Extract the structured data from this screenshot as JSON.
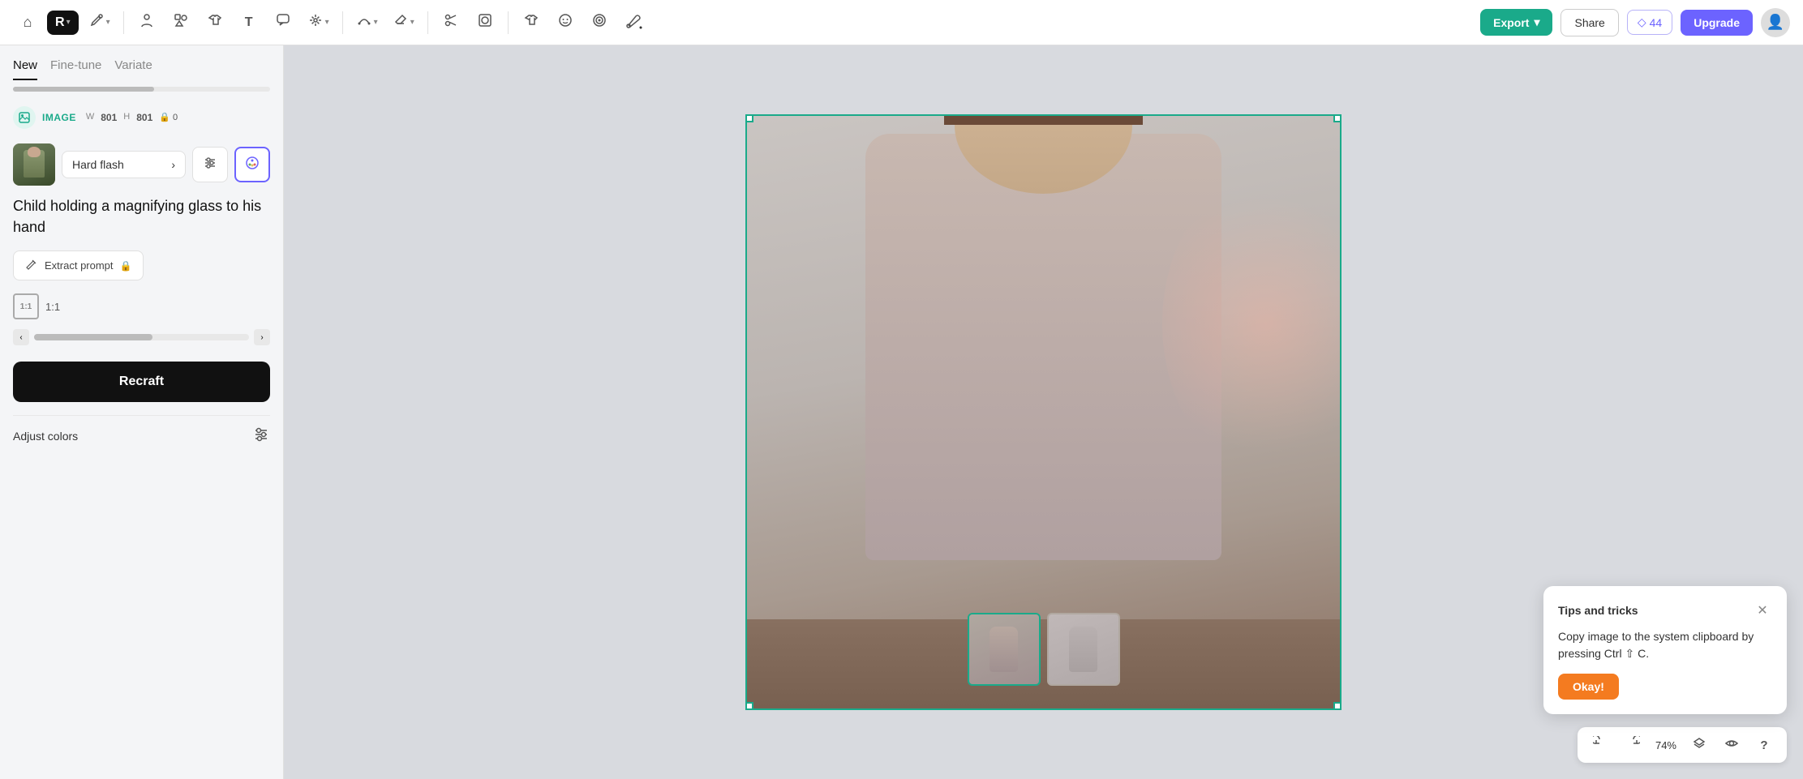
{
  "toolbar": {
    "home_icon": "⌂",
    "logo_label": "R",
    "arrow_icon": "▾",
    "pen_icon": "✒",
    "tools": [
      {
        "name": "person-icon",
        "label": "👤",
        "tooltip": "Character"
      },
      {
        "name": "shapes-icon",
        "label": "⬡",
        "tooltip": "Shapes"
      },
      {
        "name": "tshirt-icon",
        "label": "👕",
        "tooltip": "T-shirt"
      },
      {
        "name": "text-icon",
        "label": "T",
        "tooltip": "Text"
      },
      {
        "name": "bubble-icon",
        "label": "💬",
        "tooltip": "Speech bubble"
      },
      {
        "name": "magic-icon",
        "label": "✦",
        "tooltip": "Magic"
      },
      {
        "name": "curve-icon",
        "label": "⌒",
        "tooltip": "Curve"
      },
      {
        "name": "eraser-icon",
        "label": "◎",
        "tooltip": "Eraser"
      },
      {
        "name": "scissors-icon",
        "label": "✂",
        "tooltip": "Scissors"
      },
      {
        "name": "mask-icon",
        "label": "⊞",
        "tooltip": "Mask"
      },
      {
        "name": "shirt2-icon",
        "label": "👕",
        "tooltip": "Shirt 2"
      },
      {
        "name": "face-icon",
        "label": "☺",
        "tooltip": "Face"
      },
      {
        "name": "target-icon",
        "label": "◎",
        "tooltip": "Target"
      },
      {
        "name": "paint-icon",
        "label": "🖌",
        "tooltip": "Paint"
      }
    ],
    "export_label": "Export",
    "share_label": "Share",
    "credits_icon": "◇",
    "credits_count": "44",
    "upgrade_label": "Upgrade"
  },
  "left_panel": {
    "tabs": [
      {
        "label": "New",
        "active": true
      },
      {
        "label": "Fine-tune",
        "active": false
      },
      {
        "label": "Variate",
        "active": false
      }
    ],
    "image_meta": {
      "icon": "◉",
      "label": "IMAGE",
      "w_label": "W",
      "w_value": "801",
      "h_label": "H",
      "h_value": "801",
      "lock_value": "0"
    },
    "style": {
      "name": "Hard flash",
      "arrow": "›"
    },
    "prompt": {
      "text": "Child holding a magnifying glass to his hand"
    },
    "extract_prompt": {
      "label": "Extract prompt",
      "lock_icon": "🔒"
    },
    "ratio": {
      "label": "1:1"
    },
    "recraft_btn": "Recraft",
    "adjust_colors": "Adjust colors"
  },
  "canvas": {
    "zoom_level": "74%"
  },
  "tips": {
    "title": "Tips and tricks",
    "body": "Copy image to the system clipboard by pressing Ctrl ⇧ C.",
    "okay_label": "Okay!"
  },
  "bottom_toolbar": {
    "undo_icon": "↩",
    "redo_icon": "↪",
    "layers_icon": "⬡",
    "eye_icon": "👁",
    "help_icon": "?"
  }
}
